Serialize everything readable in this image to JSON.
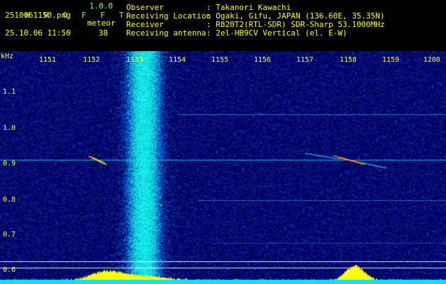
{
  "app": {
    "title_letters": [
      "H",
      "R",
      "O",
      "F",
      "F",
      "T"
    ],
    "version": "1.0.0",
    "filename": "2510061150.png",
    "datetime": "25.10.06 11:50",
    "mode": "meteor",
    "count": "38"
  },
  "info": {
    "observer_key": "Observer",
    "observer_val": ": Takanori Kawachi",
    "location_key": "Receiving Location",
    "location_val": ": Ogaki, Gifu, JAPAN (136.60E, 35.35N)",
    "receiver_key": "Receiver",
    "receiver_val": ": R820T2(RTL-SDR) SDR-Sharp 53.1000MHz",
    "antenna_key": "Receiving antenna",
    "antenna_val": ": 2el-HB9CV Vertical (el. E-W)"
  },
  "axis": {
    "y_unit": "kHz",
    "y_ticks": [
      "1.1",
      "1.0",
      "0.9",
      "0.8",
      "0.7",
      "0.6"
    ],
    "x_ticks": [
      "1151",
      "1152",
      "1153",
      "1154",
      "1155",
      "1156",
      "1157",
      "1158",
      "1159",
      "1200"
    ]
  },
  "colors": {
    "text": "#ffff00",
    "title": "#7cff7c",
    "signal": "#00e5ff",
    "background": "#000080"
  }
}
